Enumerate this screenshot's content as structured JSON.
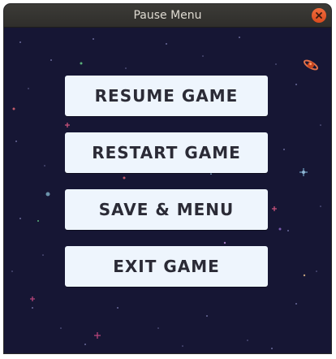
{
  "window": {
    "title": "Pause Menu"
  },
  "menu": {
    "resume_label": "RESUME GAME",
    "restart_label": "RESTART GAME",
    "save_label": "SAVE & MENU",
    "exit_label": "EXIT GAME"
  },
  "icons": {
    "close": "close-icon",
    "planet": "planet-icon"
  },
  "colors": {
    "background": "#161634",
    "button": "#eef5fd",
    "button_text": "#2b2b36",
    "close": "#e9541f"
  }
}
